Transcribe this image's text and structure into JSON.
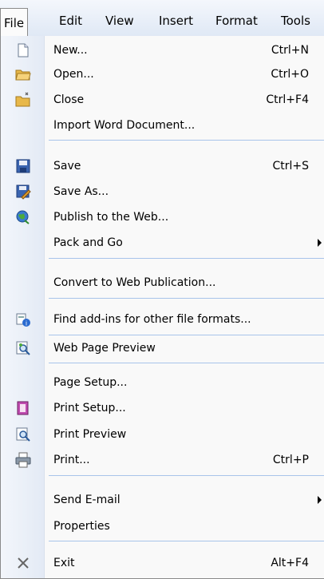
{
  "menubar": {
    "items": [
      {
        "label": "File"
      },
      {
        "label": "Edit"
      },
      {
        "label": "View"
      },
      {
        "label": "Insert"
      },
      {
        "label": "Format"
      },
      {
        "label": "Tools"
      }
    ]
  },
  "file_menu": {
    "items": [
      {
        "label": "New...",
        "shortcut": "Ctrl+N",
        "icon": "new-document-icon"
      },
      {
        "label": "Open...",
        "shortcut": "Ctrl+O",
        "icon": "open-folder-icon"
      },
      {
        "label": "Close",
        "shortcut": "Ctrl+F4",
        "icon": "close-folder-icon"
      },
      {
        "label": "Import Word Document..."
      },
      {
        "label": "Save",
        "shortcut": "Ctrl+S",
        "icon": "save-icon"
      },
      {
        "label": "Save As...",
        "icon": "save-as-icon"
      },
      {
        "label": "Publish to the Web...",
        "icon": "globe-icon"
      },
      {
        "label": "Pack and Go",
        "submenu": true
      },
      {
        "label": "Convert to Web Publication..."
      },
      {
        "label": "Find add-ins for other file formats...",
        "icon": "add-ins-icon"
      },
      {
        "label": "Web Page Preview",
        "icon": "web-preview-icon"
      },
      {
        "label": "Page Setup..."
      },
      {
        "label": "Print Setup...",
        "icon": "print-setup-icon"
      },
      {
        "label": "Print Preview",
        "icon": "print-preview-icon"
      },
      {
        "label": "Print...",
        "shortcut": "Ctrl+P",
        "icon": "printer-icon"
      },
      {
        "label": "Send E-mail",
        "submenu": true
      },
      {
        "label": "Properties"
      },
      {
        "label": "Exit",
        "shortcut": "Alt+F4",
        "icon": "exit-x-icon"
      }
    ]
  }
}
